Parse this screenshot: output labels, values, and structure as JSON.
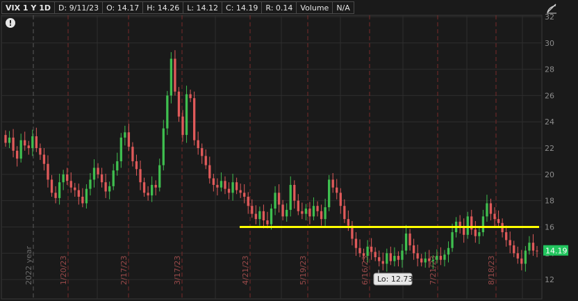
{
  "header": {
    "symbol": "VIX 1 Y 1D",
    "date": "D: 9/11/23",
    "open": "O: 14.17",
    "high": "H: 14.26",
    "low": "L: 14.12",
    "close": "C: 14.19",
    "range": "R: 0.14",
    "volume_label": "Volume",
    "volume_value": "N/A"
  },
  "alert_icon_glyph": "!",
  "icons": {
    "alert": "exclamation-circle-icon",
    "expand": "expand-chart-icon"
  },
  "colors": {
    "background": "#1a1a1a",
    "grid": "#2e2e2e",
    "axis_text": "#8c8c8c",
    "up": "#3fbf4f",
    "down": "#e05a5a",
    "month_marker": "#7a2a2a",
    "support_line": "#ffff00",
    "price_bubble": "#22c55e",
    "low_bubble_bg": "#e8e8e8"
  },
  "chart_data": {
    "type": "candlestick",
    "symbol": "VIX",
    "ylim": [
      11,
      32
    ],
    "y_ticks": [
      12,
      14,
      16,
      18,
      20,
      22,
      24,
      26,
      28,
      30,
      32
    ],
    "x_markers": [
      {
        "label": "2022 year",
        "style": "year"
      },
      {
        "label": "1/20/23"
      },
      {
        "label": "2/17/23"
      },
      {
        "label": "3/17/23"
      },
      {
        "label": "4/21/23"
      },
      {
        "label": "5/19/23"
      },
      {
        "label": "6/16/23"
      },
      {
        "label": "7/21/23"
      },
      {
        "label": "8/18/23"
      }
    ],
    "last_price": "14.19",
    "low_label": "Lo: 12.73",
    "low_value": 12.73,
    "support_level": 16,
    "series": [
      {
        "o": 23,
        "c": 22.4
      },
      {
        "o": 22.4,
        "c": 22.8
      },
      {
        "o": 22.8,
        "c": 21.8
      },
      {
        "o": 21.8,
        "c": 21.2
      },
      {
        "o": 21.2,
        "c": 22.6
      },
      {
        "o": 22.6,
        "c": 22.2
      },
      {
        "o": 22.2,
        "c": 22.0
      },
      {
        "o": 22.0,
        "c": 22.9
      },
      {
        "o": 22.9,
        "c": 22.0
      },
      {
        "o": 22.0,
        "c": 21.5
      },
      {
        "o": 21.5,
        "c": 20.8
      },
      {
        "o": 20.8,
        "c": 19.6
      },
      {
        "o": 19.6,
        "c": 18.6
      },
      {
        "o": 18.6,
        "c": 18.2
      },
      {
        "o": 18.2,
        "c": 19.4
      },
      {
        "o": 19.4,
        "c": 20.0
      },
      {
        "o": 20.0,
        "c": 19.5
      },
      {
        "o": 19.5,
        "c": 19.0
      },
      {
        "o": 19.0,
        "c": 18.8
      },
      {
        "o": 18.8,
        "c": 18.3
      },
      {
        "o": 18.3,
        "c": 17.8
      },
      {
        "o": 17.8,
        "c": 18.9
      },
      {
        "o": 18.9,
        "c": 19.6
      },
      {
        "o": 19.6,
        "c": 20.5
      },
      {
        "o": 20.5,
        "c": 20.0
      },
      {
        "o": 20.0,
        "c": 19.4
      },
      {
        "o": 19.4,
        "c": 18.7
      },
      {
        "o": 18.7,
        "c": 19.1
      },
      {
        "o": 19.1,
        "c": 20.3
      },
      {
        "o": 20.3,
        "c": 21.0
      },
      {
        "o": 21.0,
        "c": 22.8
      },
      {
        "o": 22.8,
        "c": 23.2
      },
      {
        "o": 23.2,
        "c": 22.1
      },
      {
        "o": 22.1,
        "c": 21.0
      },
      {
        "o": 21.0,
        "c": 20.4
      },
      {
        "o": 20.4,
        "c": 19.4
      },
      {
        "o": 19.4,
        "c": 18.6
      },
      {
        "o": 18.6,
        "c": 18.4
      },
      {
        "o": 18.4,
        "c": 19.2
      },
      {
        "o": 19.2,
        "c": 19.0
      },
      {
        "o": 19.0,
        "c": 20.7
      },
      {
        "o": 20.7,
        "c": 23.5
      },
      {
        "o": 23.5,
        "c": 26.0
      },
      {
        "o": 26.0,
        "c": 28.8
      },
      {
        "o": 28.8,
        "c": 26.3
      },
      {
        "o": 26.3,
        "c": 24.4
      },
      {
        "o": 24.4,
        "c": 23.0
      },
      {
        "o": 23.0,
        "c": 26.1
      },
      {
        "o": 26.1,
        "c": 25.8
      },
      {
        "o": 25.8,
        "c": 22.6
      },
      {
        "o": 22.6,
        "c": 22.0
      },
      {
        "o": 22.0,
        "c": 21.4
      },
      {
        "o": 21.4,
        "c": 20.7
      },
      {
        "o": 20.7,
        "c": 19.7
      },
      {
        "o": 19.7,
        "c": 19.2
      },
      {
        "o": 19.2,
        "c": 19.0
      },
      {
        "o": 19.0,
        "c": 19.5
      },
      {
        "o": 19.5,
        "c": 18.9
      },
      {
        "o": 18.9,
        "c": 18.6
      },
      {
        "o": 18.6,
        "c": 19.4
      },
      {
        "o": 19.4,
        "c": 18.8
      },
      {
        "o": 18.8,
        "c": 18.6
      },
      {
        "o": 18.6,
        "c": 18.3
      },
      {
        "o": 18.3,
        "c": 17.6
      },
      {
        "o": 17.6,
        "c": 17.0
      },
      {
        "o": 17.0,
        "c": 16.6
      },
      {
        "o": 16.6,
        "c": 17.2
      },
      {
        "o": 17.2,
        "c": 16.5
      },
      {
        "o": 16.5,
        "c": 16.2
      },
      {
        "o": 16.2,
        "c": 17.4
      },
      {
        "o": 17.4,
        "c": 18.6
      },
      {
        "o": 18.6,
        "c": 17.7
      },
      {
        "o": 17.7,
        "c": 16.8
      },
      {
        "o": 16.8,
        "c": 17.3
      },
      {
        "o": 17.3,
        "c": 19.2
      },
      {
        "o": 19.2,
        "c": 18.0
      },
      {
        "o": 18.0,
        "c": 17.2
      },
      {
        "o": 17.2,
        "c": 17.0
      },
      {
        "o": 17.0,
        "c": 17.4
      },
      {
        "o": 17.4,
        "c": 16.8
      },
      {
        "o": 16.8,
        "c": 17.6
      },
      {
        "o": 17.6,
        "c": 17.2
      },
      {
        "o": 17.2,
        "c": 16.6
      },
      {
        "o": 16.6,
        "c": 17.5
      },
      {
        "o": 17.5,
        "c": 19.6
      },
      {
        "o": 19.6,
        "c": 19.0
      },
      {
        "o": 19.0,
        "c": 18.6
      },
      {
        "o": 18.6,
        "c": 17.6
      },
      {
        "o": 17.6,
        "c": 16.6
      },
      {
        "o": 16.6,
        "c": 16.1
      },
      {
        "o": 16.1,
        "c": 15.1
      },
      {
        "o": 15.1,
        "c": 14.4
      },
      {
        "o": 14.4,
        "c": 14.0
      },
      {
        "o": 14.0,
        "c": 13.8
      },
      {
        "o": 13.8,
        "c": 14.5
      },
      {
        "o": 14.5,
        "c": 14.1
      },
      {
        "o": 14.1,
        "c": 13.7
      },
      {
        "o": 13.7,
        "c": 13.4
      },
      {
        "o": 13.4,
        "c": 13.2
      },
      {
        "o": 13.2,
        "c": 14.0
      },
      {
        "o": 14.0,
        "c": 13.4
      },
      {
        "o": 13.4,
        "c": 13.8
      },
      {
        "o": 13.8,
        "c": 13.5
      },
      {
        "o": 13.5,
        "c": 14.2
      },
      {
        "o": 14.2,
        "c": 15.5
      },
      {
        "o": 15.5,
        "c": 14.6
      },
      {
        "o": 14.6,
        "c": 14.0
      },
      {
        "o": 14.0,
        "c": 13.6
      },
      {
        "o": 13.6,
        "c": 13.3
      },
      {
        "o": 13.3,
        "c": 13.6
      },
      {
        "o": 13.6,
        "c": 13.4
      },
      {
        "o": 13.4,
        "c": 13.5
      },
      {
        "o": 13.5,
        "c": 13.8
      },
      {
        "o": 13.8,
        "c": 13.5
      },
      {
        "o": 13.5,
        "c": 13.9
      },
      {
        "o": 13.9,
        "c": 14.4
      },
      {
        "o": 14.4,
        "c": 15.6
      },
      {
        "o": 15.6,
        "c": 16.4
      },
      {
        "o": 16.4,
        "c": 16.0
      },
      {
        "o": 16.0,
        "c": 15.4
      },
      {
        "o": 15.4,
        "c": 16.8
      },
      {
        "o": 16.8,
        "c": 15.8
      },
      {
        "o": 15.8,
        "c": 15.3
      },
      {
        "o": 15.3,
        "c": 15.6
      },
      {
        "o": 15.6,
        "c": 16.8
      },
      {
        "o": 16.8,
        "c": 17.8
      },
      {
        "o": 17.8,
        "c": 17.0
      },
      {
        "o": 17.0,
        "c": 16.6
      },
      {
        "o": 16.6,
        "c": 16.3
      },
      {
        "o": 16.3,
        "c": 15.6
      },
      {
        "o": 15.6,
        "c": 15.0
      },
      {
        "o": 15.0,
        "c": 14.6
      },
      {
        "o": 14.6,
        "c": 14.0
      },
      {
        "o": 14.0,
        "c": 13.6
      },
      {
        "o": 13.6,
        "c": 13.2
      },
      {
        "o": 13.2,
        "c": 14.2
      },
      {
        "o": 14.2,
        "c": 14.8
      },
      {
        "o": 14.8,
        "c": 14.2
      },
      {
        "o": 14.2,
        "c": 14.19
      }
    ]
  }
}
